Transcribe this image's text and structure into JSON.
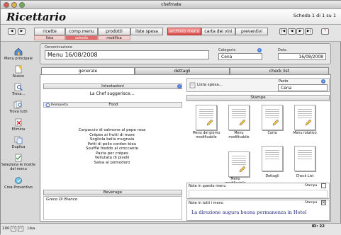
{
  "window": {
    "title": "chefmate"
  },
  "app": {
    "title": "Ricettario",
    "record_counter": "Scheda 1 di 1 su 1"
  },
  "nav_tabs": [
    {
      "label": "ricette",
      "active": false
    },
    {
      "label": "comp.menu",
      "active": false
    },
    {
      "label": "prodotti",
      "active": false
    },
    {
      "label": "liste spesa",
      "active": false
    },
    {
      "label": "archivio menu",
      "active": true
    },
    {
      "label": "carta dei vini",
      "active": false
    },
    {
      "label": "preventivi",
      "active": false
    }
  ],
  "sub_tabs": [
    {
      "label": "lista",
      "active": false
    },
    {
      "label": "scheda",
      "active": true
    },
    {
      "label": "modifica",
      "active": false
    }
  ],
  "help_button": "?",
  "sidebar": [
    {
      "label": "Menu principale",
      "icon": "home-icon"
    },
    {
      "label": "Nuovo",
      "icon": "new-icon"
    },
    {
      "label": "Trova...",
      "icon": "find-icon"
    },
    {
      "label": "Trova tutti",
      "icon": "find-all-icon"
    },
    {
      "label": "Elimina",
      "icon": "delete-icon"
    },
    {
      "label": "Duplica",
      "icon": "duplicate-icon"
    },
    {
      "label": "Seleziona le ricette del menu",
      "icon": "select-recipes-icon"
    },
    {
      "label": "Crea Preventivo",
      "icon": "quote-icon"
    }
  ],
  "record": {
    "denominazione_label": "Denominazione",
    "denominazione_value": "Menu 16/08/2008",
    "categoria_label": "Categoria",
    "categoria_value": "Cena",
    "data_label": "Data",
    "data_value": "16/08/2008"
  },
  "panel_tabs": [
    {
      "label": "generale",
      "active": true
    },
    {
      "label": "dettagli",
      "active": false
    },
    {
      "label": "check list",
      "active": false
    }
  ],
  "left": {
    "intestazioni_label": "Intestazioni",
    "chef_line": "La Chef suggerisce...",
    "reimposta_label": "Reimposta",
    "food_label": "Food",
    "dishes": [
      "Carpaccio di salmone al pepe rosa",
      "Crêpes ai frutti di mare",
      "Sogliola bella mugnaia",
      "Petti di pollo cordon bleu",
      "Soufflé freddo al croccante",
      "Pasta per crêpes",
      "Vellutata di piselli",
      "Salsa al pomodoro"
    ],
    "beverage_label": "Beverage",
    "beverage_value": "Greco Di Bianco"
  },
  "right": {
    "lista_spesa_label": "Lista spesa...",
    "pasto_label": "Pasto",
    "pasto_value": "Cena",
    "stampe_label": "Stampe",
    "prints": [
      "Menu del giorno modificabile",
      "Menu modificabile",
      "Carta",
      "Menu rotativo",
      "Menu modificabile",
      "Dettagli",
      "Check List"
    ],
    "note_menu_label": "Note in questo menu",
    "note_all_label": "Note in tutti i menu",
    "note_all_value": "La direzione augura buona permanenza in Hotel",
    "stampa_label": "Stampa"
  },
  "status": {
    "zoom": "100",
    "mode": "Usa",
    "id_label": "ID: 22"
  },
  "colors": {
    "accent": "#d94b4b",
    "chip": "#4d7bd6",
    "note_text": "#1a237e"
  }
}
